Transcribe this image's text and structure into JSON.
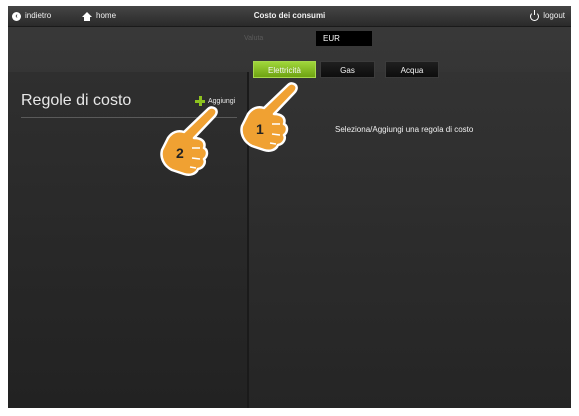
{
  "topbar": {
    "back_label": "indietro",
    "home_label": "home",
    "title": "Costo dei consumi",
    "logout_label": "logout"
  },
  "valuta": {
    "label": "Valuta",
    "value": "EUR"
  },
  "left_panel": {
    "title": "Regole di costo",
    "add_label": "Aggiungi"
  },
  "tabs": [
    {
      "label": "Elettricità",
      "active": true
    },
    {
      "label": "Gas",
      "active": false
    },
    {
      "label": "Acqua",
      "active": false
    }
  ],
  "main": {
    "message": "Seleziona/Aggiungi una regola di costo"
  },
  "annotations": [
    {
      "number": "1"
    },
    {
      "number": "2"
    }
  ],
  "colors": {
    "accent_green": "#8dc21f",
    "hand_orange": "#f0a132"
  }
}
